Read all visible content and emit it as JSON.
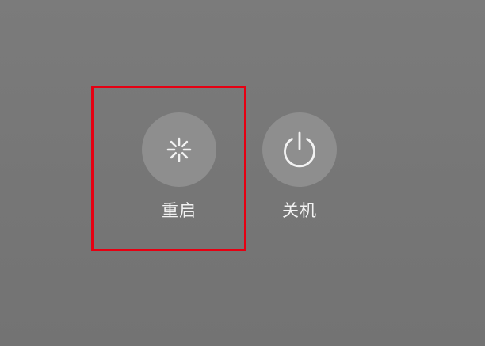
{
  "power_menu": {
    "restart": {
      "label": "重启",
      "icon": "restart-spinner-icon"
    },
    "shutdown": {
      "label": "关机",
      "icon": "power-icon"
    }
  },
  "annotation": {
    "kind": "highlight-box",
    "color": "#e60012",
    "target": "restart"
  },
  "colors": {
    "background": "#777777",
    "button_fill": "#8e8e8e",
    "icon_and_text": "#f2f2f2"
  }
}
